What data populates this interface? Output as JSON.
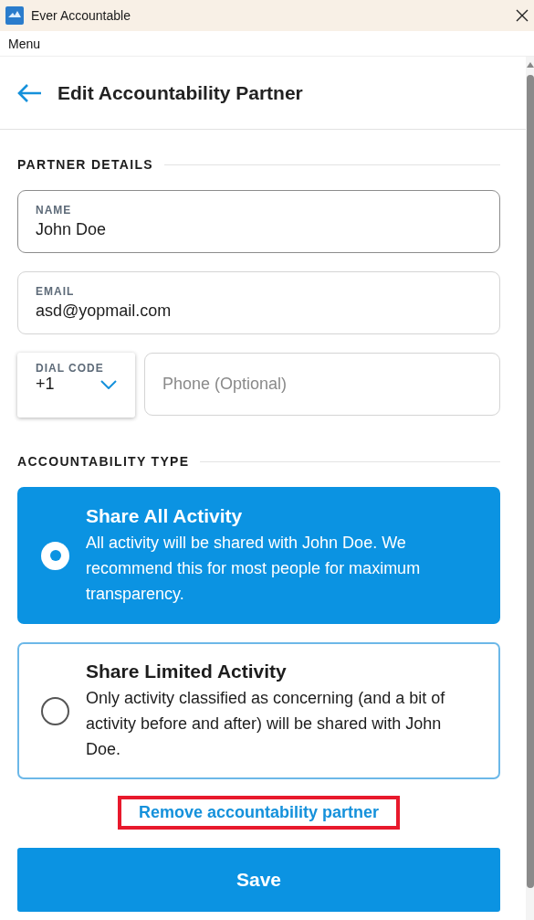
{
  "window": {
    "title": "Ever Accountable"
  },
  "menu_bar": {
    "label": "Menu"
  },
  "header": {
    "title": "Edit Accountability Partner"
  },
  "partner_details": {
    "heading": "PARTNER DETAILS",
    "name": {
      "label": "NAME",
      "value": "John Doe"
    },
    "email": {
      "label": "EMAIL",
      "value": "asd@yopmail.com"
    },
    "dial_code": {
      "label": "DIAL CODE",
      "value": "+1"
    },
    "phone": {
      "placeholder": "Phone (Optional)"
    }
  },
  "accountability_type": {
    "heading": "ACCOUNTABILITY TYPE",
    "options": [
      {
        "title": "Share All Activity",
        "description": "All activity will be shared with John Doe. We recommend this for most people for maximum transparency.",
        "selected": true
      },
      {
        "title": "Share Limited Activity",
        "description": "Only activity classified as concerning (and a bit of activity before and after) will be shared with John Doe.",
        "selected": false
      }
    ]
  },
  "remove_link": {
    "label": "Remove accountability partner",
    "highlighted": true
  },
  "save_button": {
    "label": "Save"
  }
}
